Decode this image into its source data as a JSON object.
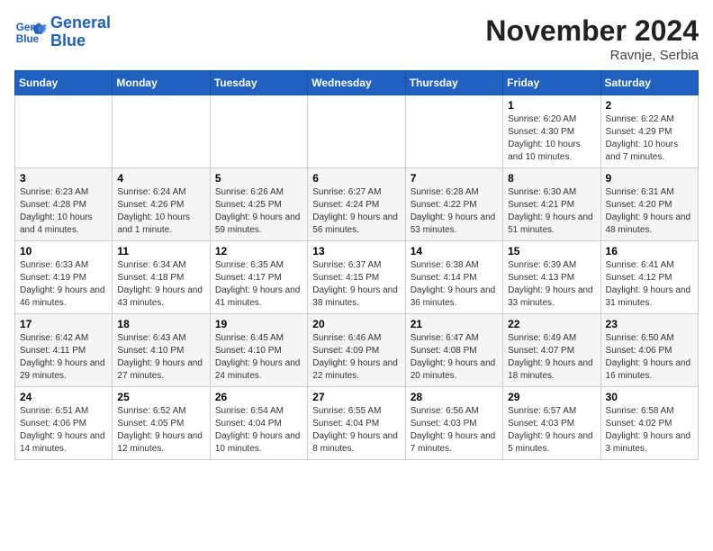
{
  "logo": {
    "line1": "General",
    "line2": "Blue"
  },
  "header": {
    "month": "November 2024",
    "location": "Ravnje, Serbia"
  },
  "weekdays": [
    "Sunday",
    "Monday",
    "Tuesday",
    "Wednesday",
    "Thursday",
    "Friday",
    "Saturday"
  ],
  "weeks": [
    [
      {
        "day": "",
        "info": ""
      },
      {
        "day": "",
        "info": ""
      },
      {
        "day": "",
        "info": ""
      },
      {
        "day": "",
        "info": ""
      },
      {
        "day": "",
        "info": ""
      },
      {
        "day": "1",
        "info": "Sunrise: 6:20 AM\nSunset: 4:30 PM\nDaylight: 10 hours and 10 minutes."
      },
      {
        "day": "2",
        "info": "Sunrise: 6:22 AM\nSunset: 4:29 PM\nDaylight: 10 hours and 7 minutes."
      }
    ],
    [
      {
        "day": "3",
        "info": "Sunrise: 6:23 AM\nSunset: 4:28 PM\nDaylight: 10 hours and 4 minutes."
      },
      {
        "day": "4",
        "info": "Sunrise: 6:24 AM\nSunset: 4:26 PM\nDaylight: 10 hours and 1 minute."
      },
      {
        "day": "5",
        "info": "Sunrise: 6:26 AM\nSunset: 4:25 PM\nDaylight: 9 hours and 59 minutes."
      },
      {
        "day": "6",
        "info": "Sunrise: 6:27 AM\nSunset: 4:24 PM\nDaylight: 9 hours and 56 minutes."
      },
      {
        "day": "7",
        "info": "Sunrise: 6:28 AM\nSunset: 4:22 PM\nDaylight: 9 hours and 53 minutes."
      },
      {
        "day": "8",
        "info": "Sunrise: 6:30 AM\nSunset: 4:21 PM\nDaylight: 9 hours and 51 minutes."
      },
      {
        "day": "9",
        "info": "Sunrise: 6:31 AM\nSunset: 4:20 PM\nDaylight: 9 hours and 48 minutes."
      }
    ],
    [
      {
        "day": "10",
        "info": "Sunrise: 6:33 AM\nSunset: 4:19 PM\nDaylight: 9 hours and 46 minutes."
      },
      {
        "day": "11",
        "info": "Sunrise: 6:34 AM\nSunset: 4:18 PM\nDaylight: 9 hours and 43 minutes."
      },
      {
        "day": "12",
        "info": "Sunrise: 6:35 AM\nSunset: 4:17 PM\nDaylight: 9 hours and 41 minutes."
      },
      {
        "day": "13",
        "info": "Sunrise: 6:37 AM\nSunset: 4:15 PM\nDaylight: 9 hours and 38 minutes."
      },
      {
        "day": "14",
        "info": "Sunrise: 6:38 AM\nSunset: 4:14 PM\nDaylight: 9 hours and 36 minutes."
      },
      {
        "day": "15",
        "info": "Sunrise: 6:39 AM\nSunset: 4:13 PM\nDaylight: 9 hours and 33 minutes."
      },
      {
        "day": "16",
        "info": "Sunrise: 6:41 AM\nSunset: 4:12 PM\nDaylight: 9 hours and 31 minutes."
      }
    ],
    [
      {
        "day": "17",
        "info": "Sunrise: 6:42 AM\nSunset: 4:11 PM\nDaylight: 9 hours and 29 minutes."
      },
      {
        "day": "18",
        "info": "Sunrise: 6:43 AM\nSunset: 4:10 PM\nDaylight: 9 hours and 27 minutes."
      },
      {
        "day": "19",
        "info": "Sunrise: 6:45 AM\nSunset: 4:10 PM\nDaylight: 9 hours and 24 minutes."
      },
      {
        "day": "20",
        "info": "Sunrise: 6:46 AM\nSunset: 4:09 PM\nDaylight: 9 hours and 22 minutes."
      },
      {
        "day": "21",
        "info": "Sunrise: 6:47 AM\nSunset: 4:08 PM\nDaylight: 9 hours and 20 minutes."
      },
      {
        "day": "22",
        "info": "Sunrise: 6:49 AM\nSunset: 4:07 PM\nDaylight: 9 hours and 18 minutes."
      },
      {
        "day": "23",
        "info": "Sunrise: 6:50 AM\nSunset: 4:06 PM\nDaylight: 9 hours and 16 minutes."
      }
    ],
    [
      {
        "day": "24",
        "info": "Sunrise: 6:51 AM\nSunset: 4:06 PM\nDaylight: 9 hours and 14 minutes."
      },
      {
        "day": "25",
        "info": "Sunrise: 6:52 AM\nSunset: 4:05 PM\nDaylight: 9 hours and 12 minutes."
      },
      {
        "day": "26",
        "info": "Sunrise: 6:54 AM\nSunset: 4:04 PM\nDaylight: 9 hours and 10 minutes."
      },
      {
        "day": "27",
        "info": "Sunrise: 6:55 AM\nSunset: 4:04 PM\nDaylight: 9 hours and 8 minutes."
      },
      {
        "day": "28",
        "info": "Sunrise: 6:56 AM\nSunset: 4:03 PM\nDaylight: 9 hours and 7 minutes."
      },
      {
        "day": "29",
        "info": "Sunrise: 6:57 AM\nSunset: 4:03 PM\nDaylight: 9 hours and 5 minutes."
      },
      {
        "day": "30",
        "info": "Sunrise: 6:58 AM\nSunset: 4:02 PM\nDaylight: 9 hours and 3 minutes."
      }
    ]
  ]
}
